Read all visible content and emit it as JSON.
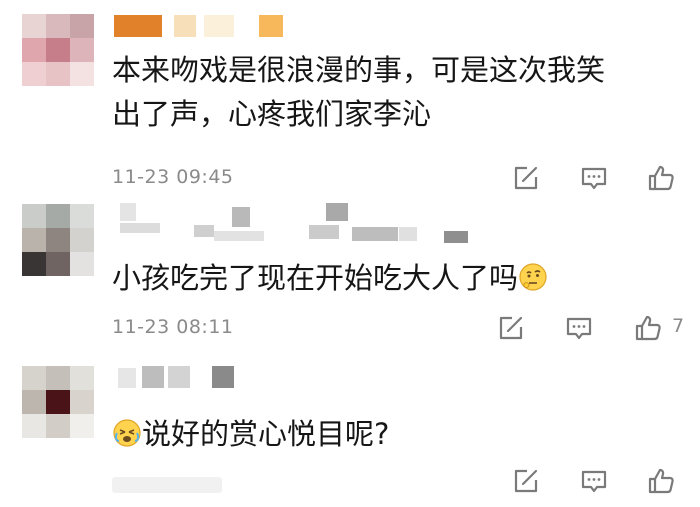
{
  "comments": [
    {
      "text": "本来吻戏是很浪漫的事，可是这次我笑",
      "text_line2": "出了声，心疼我们家李沁",
      "timestamp": "11-23 09:45",
      "like_count": ""
    },
    {
      "text": "小孩吃完了现在开始吃大人了吗",
      "timestamp": "11-23 08:11",
      "like_count": "7"
    },
    {
      "text": "说好的赏心悦目呢?",
      "timestamp": "",
      "like_count": ""
    }
  ],
  "icons": {
    "share": "share-icon",
    "reply": "comment-icon",
    "like": "thumbs-up-icon",
    "thinking_emoji": "thinking-face-emoji",
    "crying_emoji": "crying-face-emoji"
  },
  "colors": {
    "text": "#161616",
    "meta": "#8a8a8a",
    "icon": "#7a7a7a",
    "background": "#ffffff"
  }
}
